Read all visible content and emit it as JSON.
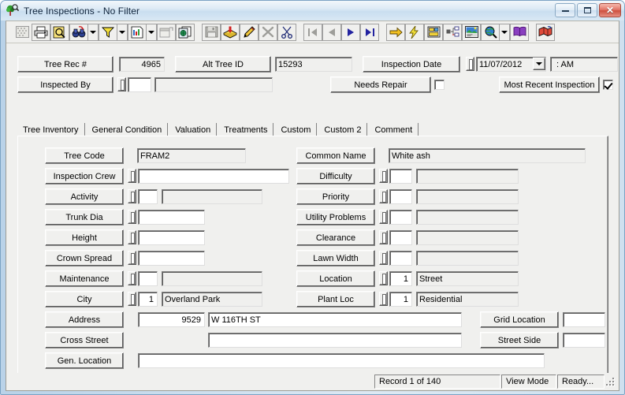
{
  "window": {
    "title": "Tree Inspections - No Filter",
    "icon": "tree-magnifier-icon",
    "buttons": {
      "minimize": "minimize",
      "maximize": "maximize",
      "close": "close"
    }
  },
  "toolbar": {
    "items": [
      {
        "name": "grid-view-button",
        "icon": "grid-icon",
        "framed": false,
        "disabled": true
      },
      {
        "name": "print-button",
        "icon": "printer-icon",
        "framed": true
      },
      {
        "name": "print-preview-button",
        "icon": "preview-magnifier-icon",
        "framed": true
      },
      {
        "name": "find-button",
        "icon": "binoculars-icon",
        "framed": true,
        "dropdown": true
      },
      {
        "name": "filter-button",
        "icon": "funnel-icon",
        "framed": true,
        "dropdown": true
      },
      {
        "name": "report-button",
        "icon": "report-page-icon",
        "framed": true,
        "dropdown": true
      },
      {
        "name": "export-button",
        "icon": "export-window-icon",
        "framed": true,
        "disabled": true
      },
      {
        "name": "duplicate-record-button",
        "icon": "copy-pages-icon",
        "framed": true
      },
      {
        "separator": true
      },
      {
        "name": "save-button",
        "icon": "floppy-disk-icon",
        "framed": true,
        "disabled": true
      },
      {
        "name": "add-record-button",
        "icon": "add-card-icon",
        "framed": true
      },
      {
        "name": "edit-record-button",
        "icon": "pencil-icon",
        "framed": true
      },
      {
        "name": "delete-record-button",
        "icon": "x-mark-icon",
        "framed": true,
        "disabled": true
      },
      {
        "name": "cut-button",
        "icon": "scissors-icon",
        "framed": true
      },
      {
        "separator": true
      },
      {
        "name": "first-record-button",
        "icon": "first-record-icon",
        "framed": true,
        "disabled": true
      },
      {
        "name": "previous-record-button",
        "icon": "previous-record-icon",
        "framed": true,
        "disabled": true
      },
      {
        "name": "next-record-button",
        "icon": "next-record-icon",
        "framed": true
      },
      {
        "name": "last-record-button",
        "icon": "last-record-icon",
        "framed": true
      },
      {
        "separator": true
      },
      {
        "name": "goto-button",
        "icon": "yellow-arrow-icon",
        "framed": true
      },
      {
        "name": "quick-action-button",
        "icon": "lightning-bolt-icon",
        "framed": true
      },
      {
        "name": "layout-button",
        "icon": "form-layout-icon",
        "framed": true
      },
      {
        "name": "tree-structure-button",
        "icon": "hierarchy-icon",
        "framed": true
      },
      {
        "name": "photo-button",
        "icon": "photo-icon",
        "framed": true
      },
      {
        "name": "map-button",
        "icon": "globe-magnifier-icon",
        "framed": true,
        "dropdown": true
      },
      {
        "name": "help-button",
        "icon": "purple-book-icon",
        "framed": true
      },
      {
        "separator": true
      },
      {
        "name": "gis-button",
        "icon": "gis-map-icon",
        "framed": true
      }
    ]
  },
  "header": {
    "tree_rec_label": "Tree Rec #",
    "tree_rec_value": "4965",
    "alt_tree_id_label": "Alt Tree ID",
    "alt_tree_id_value": "15293",
    "inspection_date_label": "Inspection Date",
    "inspection_date_value": "11/07/2012",
    "inspection_time_value": ":  AM",
    "inspected_by_label": "Inspected By",
    "inspected_by_code": "",
    "inspected_by_value": "",
    "needs_repair_label": "Needs Repair",
    "needs_repair_checked": false,
    "most_recent_label": "Most Recent Inspection",
    "most_recent_checked": true
  },
  "tabs": [
    {
      "label": "Tree Inventory",
      "active": true
    },
    {
      "label": "General Condition",
      "active": false
    },
    {
      "label": "Valuation",
      "active": false
    },
    {
      "label": "Treatments",
      "active": false
    },
    {
      "label": "Custom",
      "active": false
    },
    {
      "label": "Custom 2",
      "active": false
    },
    {
      "label": "Comment",
      "active": false
    }
  ],
  "left_fields": [
    {
      "label": "Tree Code",
      "has_spin": false,
      "code": null,
      "value": "FRAM2",
      "style": "wide-ro"
    },
    {
      "label": "Inspection Crew",
      "has_spin": true,
      "code": null,
      "value": "",
      "style": "wide-white"
    },
    {
      "label": "Activity",
      "has_spin": true,
      "code": "",
      "value": "",
      "style": "code-desc"
    },
    {
      "label": "Trunk Dia",
      "has_spin": true,
      "code": null,
      "value": "",
      "style": "mid-white"
    },
    {
      "label": "Height",
      "has_spin": true,
      "code": null,
      "value": "",
      "style": "mid-white"
    },
    {
      "label": "Crown Spread",
      "has_spin": true,
      "code": null,
      "value": "",
      "style": "mid-white"
    },
    {
      "label": "Maintenance",
      "has_spin": true,
      "code": "",
      "value": "",
      "style": "code-desc"
    },
    {
      "label": "City",
      "has_spin": true,
      "code": "1",
      "value": "Overland Park",
      "style": "code-desc"
    }
  ],
  "right_fields": [
    {
      "label": "Common Name",
      "has_spin": false,
      "code": null,
      "value": "White ash",
      "style": "wide-ro"
    },
    {
      "label": "Difficulty",
      "has_spin": true,
      "code": "",
      "value": "",
      "style": "code-desc"
    },
    {
      "label": "Priority",
      "has_spin": true,
      "code": "",
      "value": "",
      "style": "code-desc"
    },
    {
      "label": "Utility Problems",
      "has_spin": true,
      "code": "",
      "value": "",
      "style": "code-desc"
    },
    {
      "label": "Clearance",
      "has_spin": true,
      "code": "",
      "value": "",
      "style": "code-desc"
    },
    {
      "label": "Lawn Width",
      "has_spin": true,
      "code": "",
      "value": "",
      "style": "code-desc"
    },
    {
      "label": "Location",
      "has_spin": true,
      "code": "1",
      "value": "Street",
      "style": "code-desc"
    },
    {
      "label": "Plant Loc",
      "has_spin": true,
      "code": "1",
      "value": "Residential",
      "style": "code-desc"
    }
  ],
  "address_block": {
    "address_label": "Address",
    "address_number": "9529",
    "address_street": "W 116TH ST",
    "cross_street_label": "Cross Street",
    "cross_street_value": "",
    "gen_location_label": "Gen. Location",
    "gen_location_value": "",
    "grid_location_label": "Grid Location",
    "grid_location_value": "",
    "street_side_label": "Street Side",
    "street_side_value": ""
  },
  "statusbar": {
    "record": "Record 1 of 140",
    "mode": "View Mode",
    "state": "Ready..."
  },
  "colors": {
    "face": "#f0f0ee",
    "titlebar_accent": "#c9def0",
    "close_red": "#cd503f",
    "field_bg": "#ffffff"
  }
}
